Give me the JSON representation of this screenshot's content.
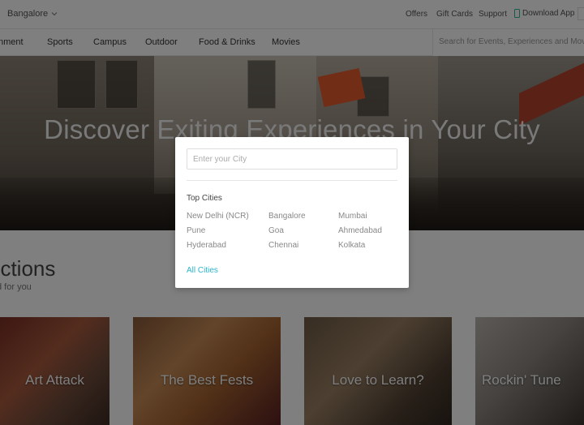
{
  "topbar": {
    "city": "Bangalore",
    "links": [
      "Offers",
      "Gift Cards",
      "Support",
      "Download App"
    ]
  },
  "nav": {
    "items": [
      "nment",
      "Sports",
      "Campus",
      "Outdoor",
      "Food & Drinks",
      "Movies"
    ],
    "search_placeholder": "Search for Events, Experiences and Movies"
  },
  "hero": {
    "title": "Discover Exiting Experiences in Your City"
  },
  "collections": {
    "title": "ections",
    "subtitle": "d for you",
    "cards": [
      "Art Attack",
      "The Best Fests",
      "Love to Learn?",
      "Rockin' Tune"
    ]
  },
  "modal": {
    "input_placeholder": "Enter your City",
    "heading": "Top Cities",
    "cities": [
      "New Delhi (NCR)",
      "Bangalore",
      "Mumbai",
      "Pune",
      "Goa",
      "Ahmedabad",
      "Hyderabad",
      "Chennai",
      "Kolkata"
    ],
    "all_cities": "All Cities"
  },
  "colors": {
    "accent": "#2bb5c9",
    "app_icon": "#2bb59a"
  }
}
